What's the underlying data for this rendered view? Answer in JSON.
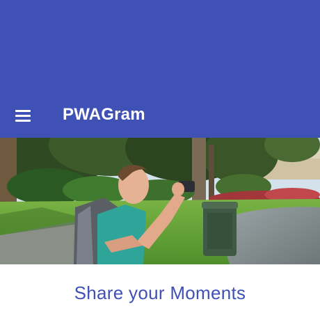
{
  "app": {
    "title": "PWAGram"
  },
  "header": {
    "menu_icon": "hamburger-menu-icon"
  },
  "hero": {
    "image": "man-taking-photo-in-park"
  },
  "main": {
    "heading": "Share your Moments"
  },
  "colors": {
    "primary": "#3f51b5",
    "background": "#ffffff"
  }
}
